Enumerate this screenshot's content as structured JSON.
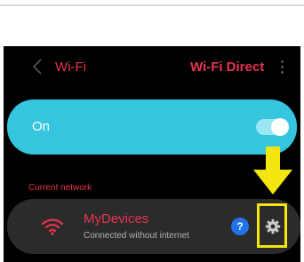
{
  "header": {
    "back_icon": "back-arrow-icon",
    "title": "Wi-Fi",
    "direct_label": "Wi-Fi Direct",
    "more_icon": "more-vertical-icon"
  },
  "toggle_card": {
    "label": "On",
    "state": "on",
    "color": "#36c5df"
  },
  "section": {
    "current_network_label": "Current network"
  },
  "network": {
    "name": "MyDevices",
    "status": "Connected without internet",
    "wifi_icon": "wifi-signal-icon",
    "help_icon": "help-icon",
    "help_glyph": "?",
    "settings_icon": "gear-icon"
  },
  "annotation": {
    "arrow_icon": "down-arrow-icon",
    "highlight_color": "#f3e610"
  },
  "colors": {
    "accent": "#e8334e",
    "background": "#000000",
    "card": "#2b2b2b"
  }
}
